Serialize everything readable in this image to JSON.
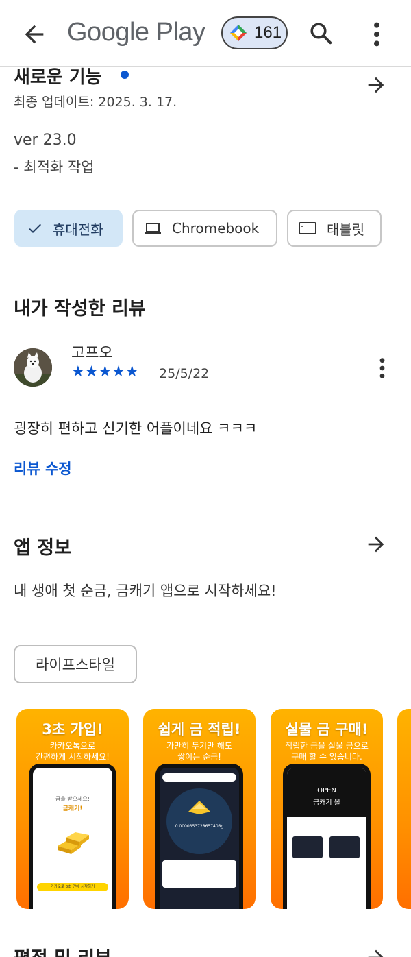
{
  "header": {
    "title": "Google Play",
    "points": "161"
  },
  "whats_new": {
    "title": "새로운 기능",
    "updated": "최종 업데이트: 2025. 3. 17.",
    "version": "ver 23.0",
    "note": "- 최적화 작업"
  },
  "devices": {
    "phone": "휴대전화",
    "chromebook": "Chromebook",
    "tablet": "태블릿"
  },
  "my_review": {
    "title": "내가 작성한 리뷰",
    "author": "고프오",
    "stars": "★★★★★",
    "rating": 5,
    "date": "25/5/22",
    "text": "굉장히 편하고 신기한 어플이네요 ㅋㅋㅋ",
    "edit": "리뷰 수정"
  },
  "app_info": {
    "title": "앱 정보",
    "description": "내 생애 첫 순금, 금캐기 앱으로 시작하세요!",
    "category": "라이프스타일"
  },
  "screenshots": [
    {
      "title": "3초 가입!",
      "subtitle": "카카오톡으로\n간편하게 시작하세요!",
      "inner_a": "금을 받으세요!",
      "inner_b": "금캐기!",
      "inner_c": "카카오로 3초 만에 시작하기"
    },
    {
      "title": "쉽게 금 적립!",
      "subtitle": "가만히 두기만 해도\n쌓이는 순금!",
      "inner_a": "0.0000353728657408g"
    },
    {
      "title": "실물 금 구매!",
      "subtitle": "적립한 금을 실물 금으로\n구매 할 수 있습니다.",
      "inner_a": "OPEN",
      "inner_b": "금캐기 몰"
    }
  ],
  "ratings": {
    "title": "평점 및 리뷰"
  },
  "colors": {
    "accent": "#0b57d0",
    "chip_selected": "#d3e7f7"
  }
}
